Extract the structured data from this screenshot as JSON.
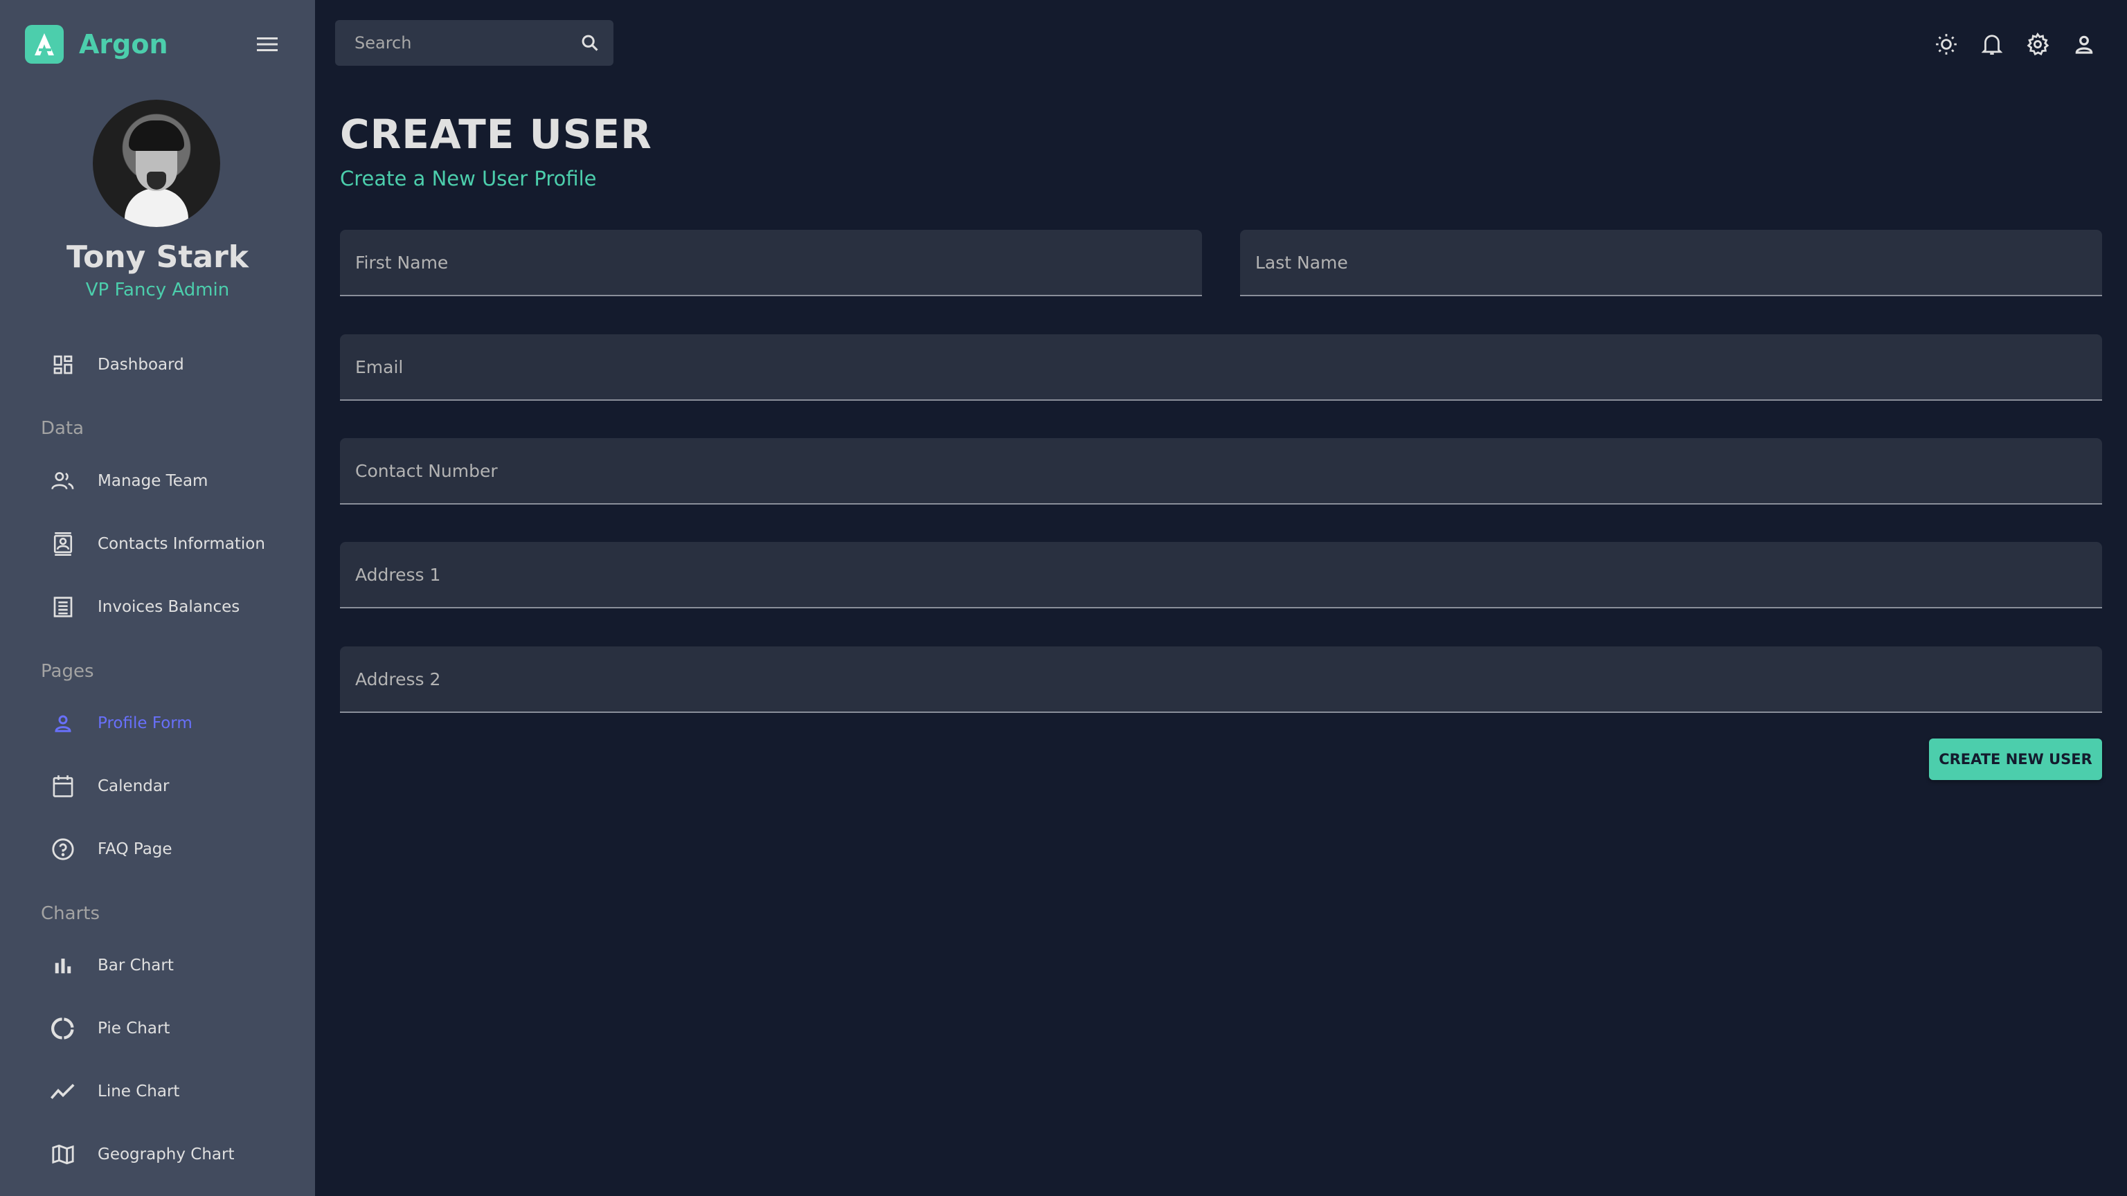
{
  "brand": {
    "name": "Argon"
  },
  "user": {
    "name": "Tony Stark",
    "role": "VP Fancy Admin"
  },
  "sidebar": {
    "dashboard": "Dashboard",
    "sections": {
      "data": "Data",
      "pages": "Pages",
      "charts": "Charts"
    },
    "data_items": [
      "Manage Team",
      "Contacts Information",
      "Invoices Balances"
    ],
    "page_items": [
      "Profile Form",
      "Calendar",
      "FAQ Page"
    ],
    "chart_items": [
      "Bar Chart",
      "Pie Chart",
      "Line Chart",
      "Geography Chart"
    ],
    "active_item": "Profile Form"
  },
  "topbar": {
    "search_placeholder": "Search",
    "icons": [
      "light-mode-icon",
      "notifications-icon",
      "settings-icon",
      "person-icon"
    ]
  },
  "main": {
    "title": "CREATE USER",
    "subtitle": "Create a New User Profile",
    "fields": {
      "first_name": "First Name",
      "last_name": "Last Name",
      "email": "Email",
      "contact": "Contact Number",
      "address1": "Address 1",
      "address2": "Address 2"
    },
    "submit_label": "CREATE NEW USER"
  },
  "colors": {
    "accent": "#4cceac",
    "active": "#6870fa",
    "background": "#141b2d",
    "sidebar": "#424b5e",
    "field": "#293040"
  }
}
